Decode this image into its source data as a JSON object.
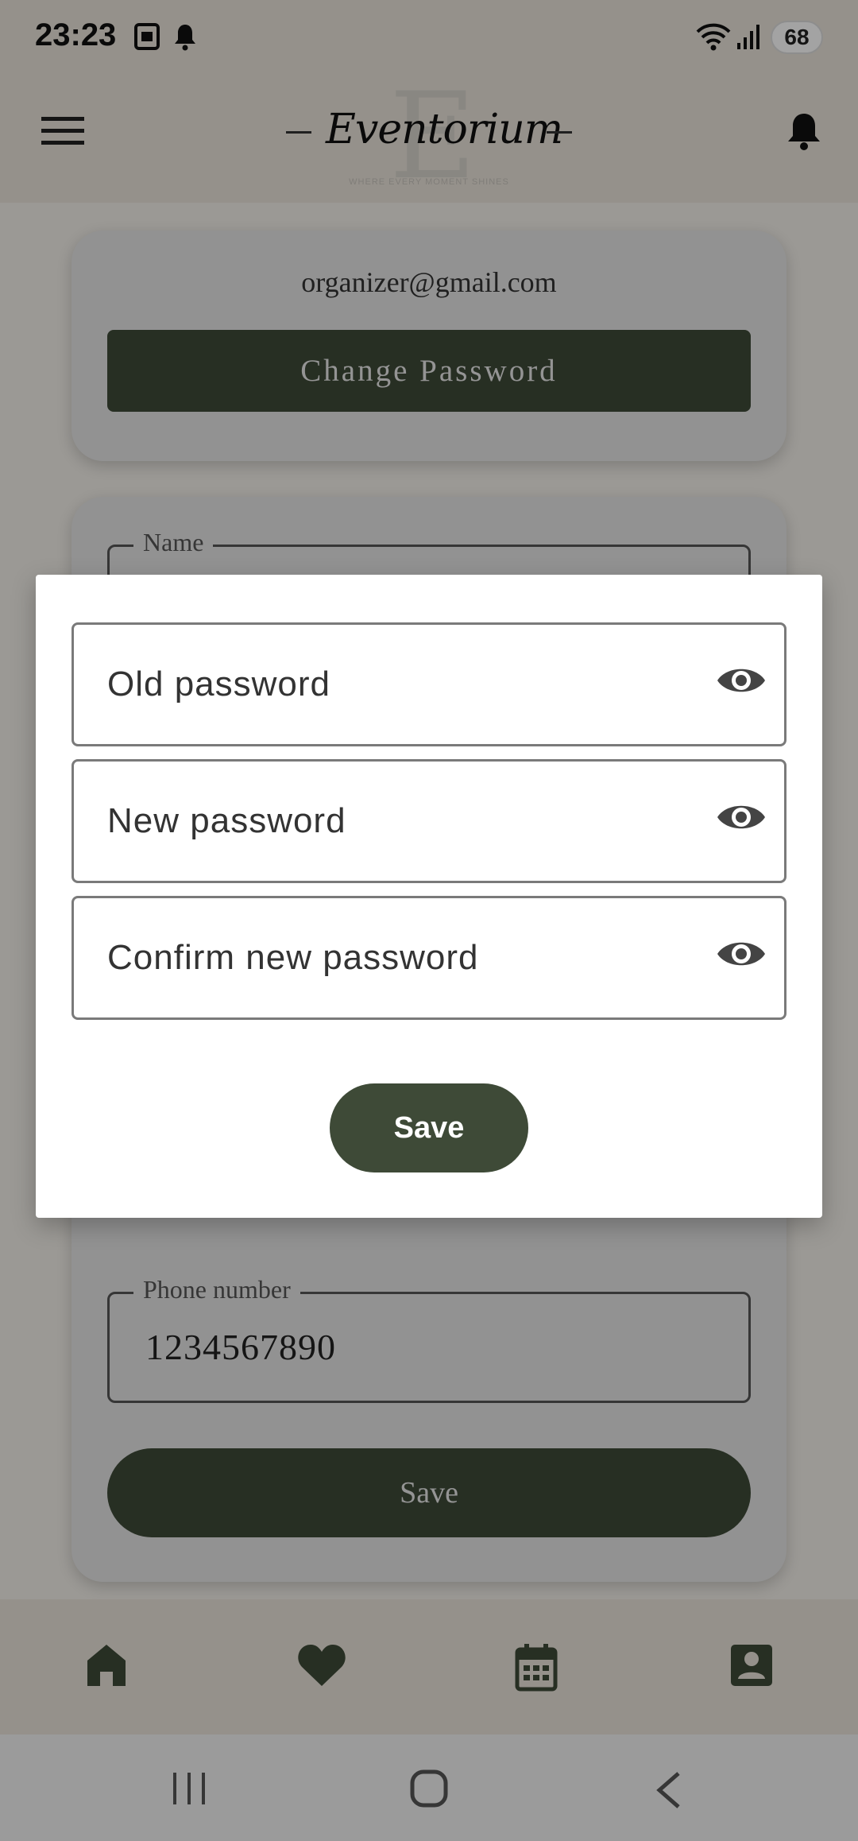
{
  "status_bar": {
    "time": "23:23",
    "battery": "68",
    "icons": [
      "screenshot-icon",
      "notification-bell-icon",
      "wifi-icon",
      "signal-icon",
      "battery-icon"
    ]
  },
  "header": {
    "logo_text": "Eventorium",
    "logo_letter": "E",
    "tagline": "WHERE EVERY MOMENT SHINES",
    "icons": [
      "menu-icon",
      "bell-icon"
    ]
  },
  "profile": {
    "email": "organizer@gmail.com",
    "change_password_label": "Change Password",
    "fields": [
      {
        "label": "Name",
        "value": ""
      },
      {
        "label": "Phone number",
        "value": "1234567890"
      }
    ],
    "save_label": "Save"
  },
  "dialog": {
    "fields": [
      {
        "placeholder": "Old password",
        "icon": "eye-icon"
      },
      {
        "placeholder": "New password",
        "icon": "eye-icon"
      },
      {
        "placeholder": "Confirm new password",
        "icon": "eye-icon"
      }
    ],
    "save_label": "Save"
  },
  "bottom_nav": {
    "items": [
      "home-icon",
      "heart-icon",
      "calendar-icon",
      "profile-icon"
    ]
  },
  "system_nav": {
    "items": [
      "recents-icon",
      "home-button-icon",
      "back-icon"
    ]
  },
  "colors": {
    "primary": "#3e4a37",
    "header_bg": "#e9e3d9",
    "card_bg": "#e4e4e4"
  }
}
